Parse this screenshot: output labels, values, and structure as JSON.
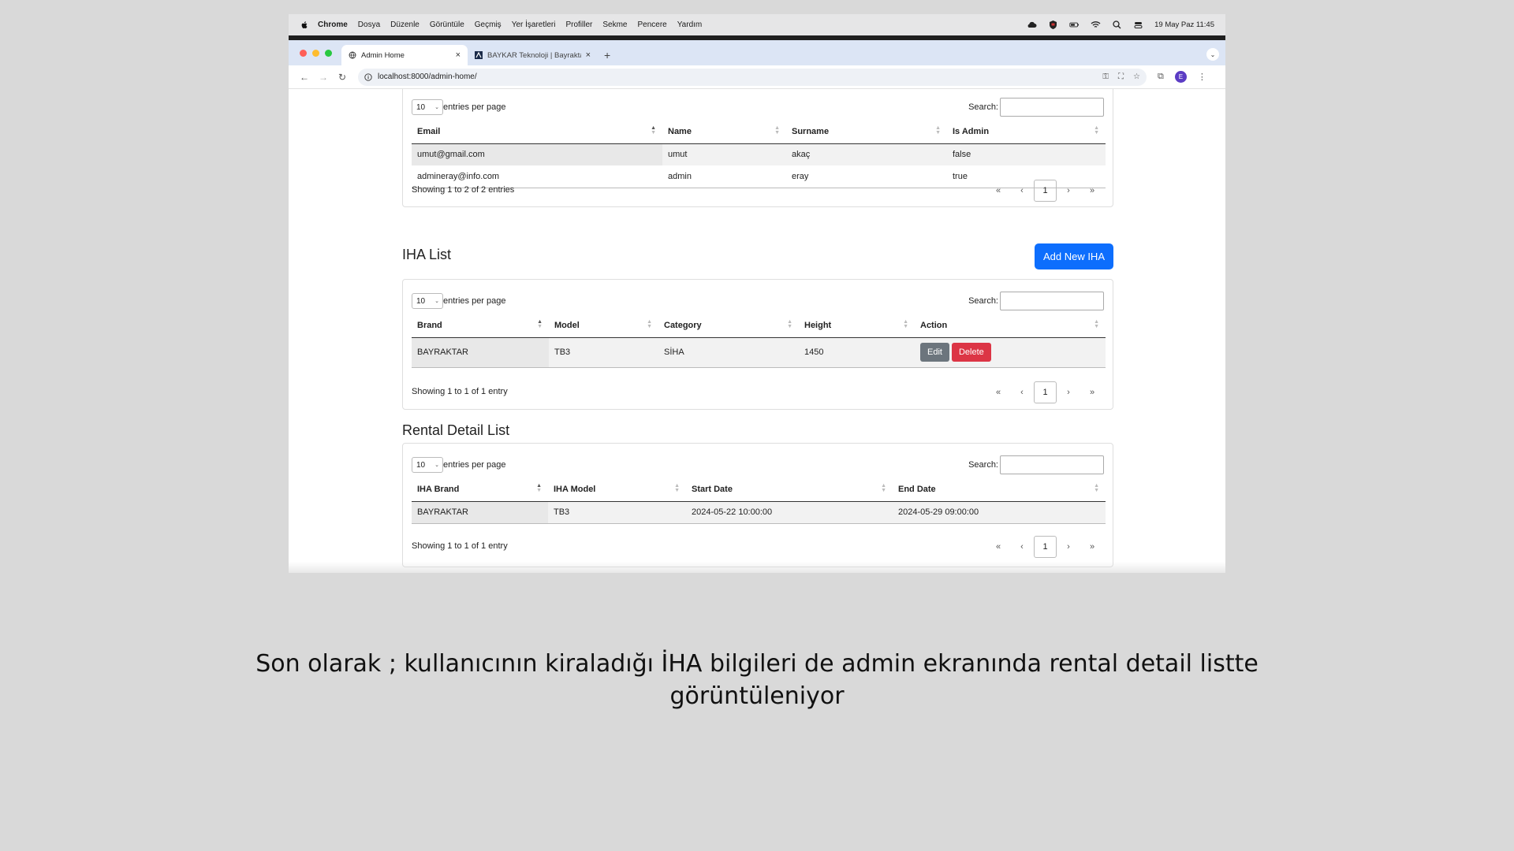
{
  "menubar": {
    "app": "Chrome",
    "items": [
      "Dosya",
      "Düzenle",
      "Görüntüle",
      "Geçmiş",
      "Yer İşaretleri",
      "Profiller",
      "Sekme",
      "Pencere",
      "Yardım"
    ],
    "clock": "19 May Paz  11:45"
  },
  "tabs": [
    {
      "title": "Admin Home",
      "close": "×"
    },
    {
      "title": "BAYKAR Teknoloji | Bayraktar",
      "close": "×"
    }
  ],
  "new_tab": "+",
  "address": {
    "url": "localhost:8000/admin-home/"
  },
  "profile_initial": "E",
  "users_table": {
    "page_size": "10",
    "entries_label": "entries per page",
    "search_label": "Search:",
    "columns": [
      "Email",
      "Name",
      "Surname",
      "Is Admin"
    ],
    "rows": [
      [
        "umut@gmail.com",
        "umut",
        "akaç",
        "false"
      ],
      [
        "admineray@info.com",
        "admin",
        "eray",
        "true"
      ]
    ],
    "info": "Showing 1 to 2 of 2 entries",
    "pager": {
      "first": "«",
      "prev": "‹",
      "current": "1",
      "next": "›",
      "last": "»"
    }
  },
  "iha_section": {
    "title": "IHA List",
    "add_button": "Add New IHA",
    "page_size": "10",
    "entries_label": "entries per page",
    "search_label": "Search:",
    "columns": [
      "Brand",
      "Model",
      "Category",
      "Height",
      "Action"
    ],
    "rows": [
      {
        "brand": "BAYRAKTAR",
        "model": "TB3",
        "category": "SİHA",
        "height": "1450",
        "edit": "Edit",
        "delete": "Delete"
      }
    ],
    "info": "Showing 1 to 1 of 1 entry",
    "pager": {
      "first": "«",
      "prev": "‹",
      "current": "1",
      "next": "›",
      "last": "»"
    }
  },
  "rental_section": {
    "title": "Rental Detail List",
    "page_size": "10",
    "entries_label": "entries per page",
    "search_label": "Search:",
    "columns": [
      "IHA Brand",
      "IHA Model",
      "Start Date",
      "End Date"
    ],
    "rows": [
      [
        "BAYRAKTAR",
        "TB3",
        "2024-05-22 10:00:00",
        "2024-05-29 09:00:00"
      ]
    ],
    "info": "Showing 1 to 1 of 1 entry",
    "pager": {
      "first": "«",
      "prev": "‹",
      "current": "1",
      "next": "›",
      "last": "»"
    }
  },
  "caption": "Son olarak ; kullanıcının kiraladığı İHA bilgileri de admin ekranında rental detail listte görüntüleniyor",
  "colors": {
    "primary": "#0d6efd",
    "danger": "#dc3545",
    "secondary": "#6c757d",
    "tabbar": "#dce5f5"
  }
}
